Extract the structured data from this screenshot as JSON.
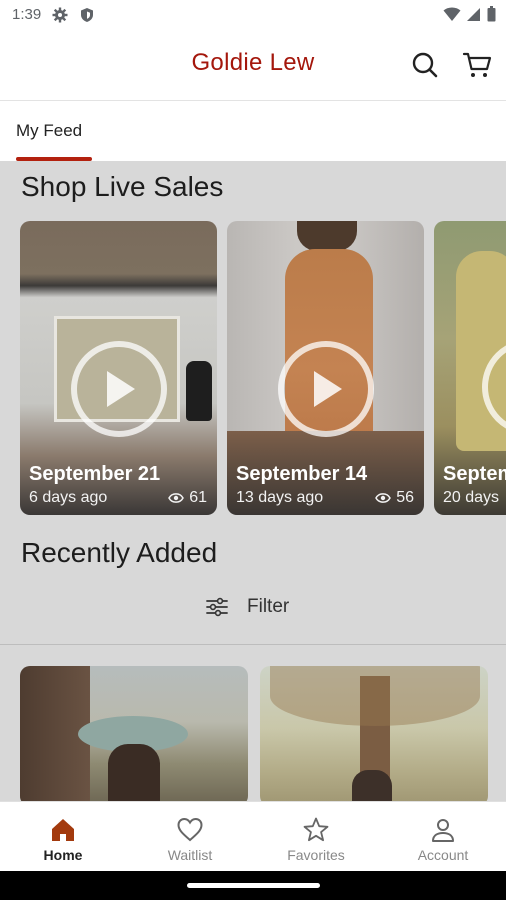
{
  "status_bar": {
    "time": "1:39"
  },
  "header": {
    "title": "Goldie Lew"
  },
  "tabs": [
    {
      "label": "My Feed"
    }
  ],
  "live_sales": {
    "title": "Shop Live Sales",
    "cards": [
      {
        "date": "September 21",
        "ago": "6 days ago",
        "views": "61"
      },
      {
        "date": "September 14",
        "ago": "13 days ago",
        "views": "56"
      },
      {
        "date": "Septem",
        "ago": "20 days"
      }
    ]
  },
  "recently_added": {
    "title": "Recently Added",
    "filter_label": "Filter"
  },
  "bottom_nav": [
    {
      "label": "Home",
      "icon": "home-icon",
      "active": true
    },
    {
      "label": "Waitlist",
      "icon": "heart-icon"
    },
    {
      "label": "Favorites",
      "icon": "star-icon"
    },
    {
      "label": "Account",
      "icon": "person-icon"
    }
  ],
  "colors": {
    "brand": "#a4170c",
    "tab_indicator": "#b3210f",
    "home_icon": "#a33a0e"
  }
}
